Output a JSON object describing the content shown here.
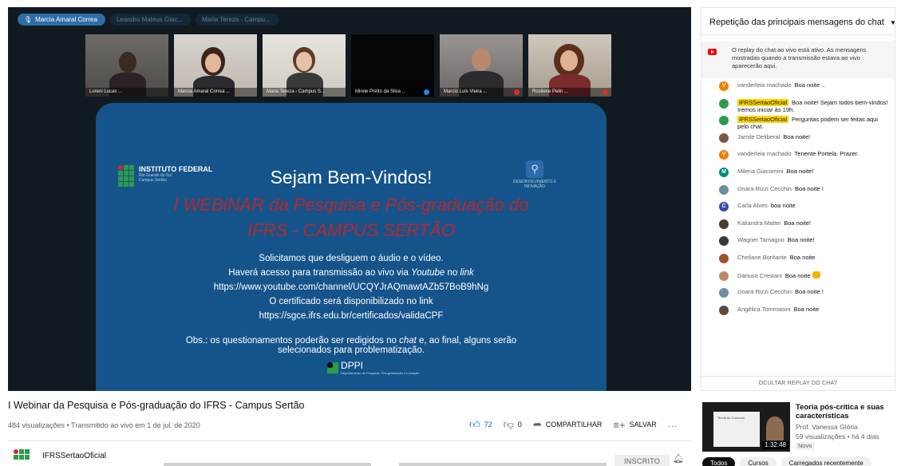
{
  "participants_bar": {
    "chips": [
      {
        "label": "Marcia Amaral Correa",
        "active": true
      },
      {
        "label": "Leandro Mateus Giac...",
        "active": false
      },
      {
        "label": "Maria Tereza - Campu...",
        "active": false
      }
    ]
  },
  "tiles": [
    {
      "name": "Loreni Lucas ..."
    },
    {
      "name": "Marcia Amaral Correa ..."
    },
    {
      "name": "Maria Tereza - Campus S..."
    },
    {
      "name": "Mirele Pretto da Silva ..."
    },
    {
      "name": "Marcio Luis Vieira ..."
    },
    {
      "name": "Rosilene Pelin ..."
    }
  ],
  "slide": {
    "welcome": "Sejam Bem-Vindos!",
    "event": "I WEBiNAR da Pesquisa e Pós-graduação do IFRS - CAMPUS SERTÃO",
    "line1": "Solicitamos que desliguem o áudio e o vídeo.",
    "line2_a": "Haverá acesso para transmissão ao vivo via ",
    "line2_b": "Youtube",
    "line2_c": " no ",
    "line2_d": "link",
    "line3": "https://www.youtube.com/channel/UCQYJrAQmawtAZb57BoB9hNg",
    "line4": "O certificado será disponibilizado no link",
    "line5": "https://sgce.ifrs.edu.br/certificados/validaCPF",
    "obs_a": "Obs.:  os questionamentos poderão ser redigidos no ",
    "obs_b": "chat",
    "obs_c": " e, ao final, alguns serão selecionados para problematização.",
    "logo_left_title": "INSTITUTO FEDERAL",
    "logo_left_sub1": "Rio Grande do Sul",
    "logo_left_sub2": "Campus Sertão",
    "logo_right_text": "DESENVOLVIMENTO E INOVAÇÃO",
    "dppi": "DPPI",
    "dppi_sub": "Departamento de Pesquisa, Pós-graduação e Inovação"
  },
  "video": {
    "title": "I Webinar da Pesquisa e Pós-graduação do IFRS - Campus Sertão",
    "meta": "484 visualizações • Transmitido ao vivo em 1 de jul. de 2020",
    "likes": "72",
    "dislikes": "0",
    "share_label": "COMPARTILHAR",
    "save_label": "SALVAR",
    "more_label": "..."
  },
  "channel": {
    "name": "IFRSSertaoOficial",
    "subscribe_label": "INSCRITO"
  },
  "chat": {
    "header": "Repetição das principais mensagens do chat",
    "notice": "O replay do chat ao vivo está ativo. As mensagens mostradas quando a transmissão estava ao vivo aparecerão aqui.",
    "footer": "OCULTAR REPLAY DO CHAT",
    "messages": [
      {
        "author": "vanderleia machado",
        "text": "Boa noite ..",
        "avatar": "V",
        "color": "#f57c00",
        "owner": false
      },
      {
        "author": "IFRSSertaoOficial",
        "text": "Boa noite! Sejam todos bem-vindos! Iremos iniciar às 19h.",
        "avatar": "",
        "color": "#2e9b4a",
        "owner": true
      },
      {
        "author": "IFRSSertaoOficial",
        "text": "Perguntas podem ser feitas aqui pelo chat.",
        "avatar": "",
        "color": "#2e9b4a",
        "owner": true
      },
      {
        "author": "Jamile Deliberal",
        "text": "Boa noite!",
        "avatar": "",
        "color": "#7a5a45",
        "owner": false
      },
      {
        "author": "vanderleia machado",
        "text": "Tenente Portela. Prazer.",
        "avatar": "V",
        "color": "#f57c00",
        "owner": false
      },
      {
        "author": "Milena Giacomini",
        "text": "Boa noite!",
        "avatar": "M",
        "color": "#00897b",
        "owner": false
      },
      {
        "author": "cinara Rizzi Cecchin",
        "text": "Boa noite !",
        "avatar": "",
        "color": "#6a8fa0",
        "owner": false
      },
      {
        "author": "Carla Alves",
        "text": "boa noite",
        "avatar": "C",
        "color": "#3949ab",
        "owner": false
      },
      {
        "author": "Kaliandra Mattei",
        "text": "Boa noite!",
        "avatar": "",
        "color": "#4a3b33",
        "owner": false
      },
      {
        "author": "Wagner Tamagno",
        "text": "Boa noite!",
        "avatar": "",
        "color": "#3a3a3a",
        "owner": false
      },
      {
        "author": "Cheilane Bonfante",
        "text": "Boa noite",
        "avatar": "",
        "color": "#a0522d",
        "owner": false
      },
      {
        "author": "Danusa Crestani",
        "text": "Boa noite",
        "avatar": "",
        "color": "#b98a6a",
        "owner": false,
        "emoji": true
      },
      {
        "author": "cinara Rizzi Cecchin",
        "text": "Boa noite !",
        "avatar": "",
        "color": "#6a8fa0",
        "owner": false
      },
      {
        "author": "Angélica Tommasini",
        "text": "Boa noite",
        "avatar": "",
        "color": "#5a4a42",
        "owner": false
      }
    ]
  },
  "related": {
    "title": "Teoria pós-crítica e suas características",
    "channel": "Prof. Vanessa Glória",
    "meta": "59 visualizações • há 4 dias",
    "badge": "Novo",
    "duration": "1:32:48",
    "thumb_text": "Teoria do Currículo"
  },
  "filters": [
    "Todos",
    "Cursos",
    "Carregados recentemente"
  ]
}
